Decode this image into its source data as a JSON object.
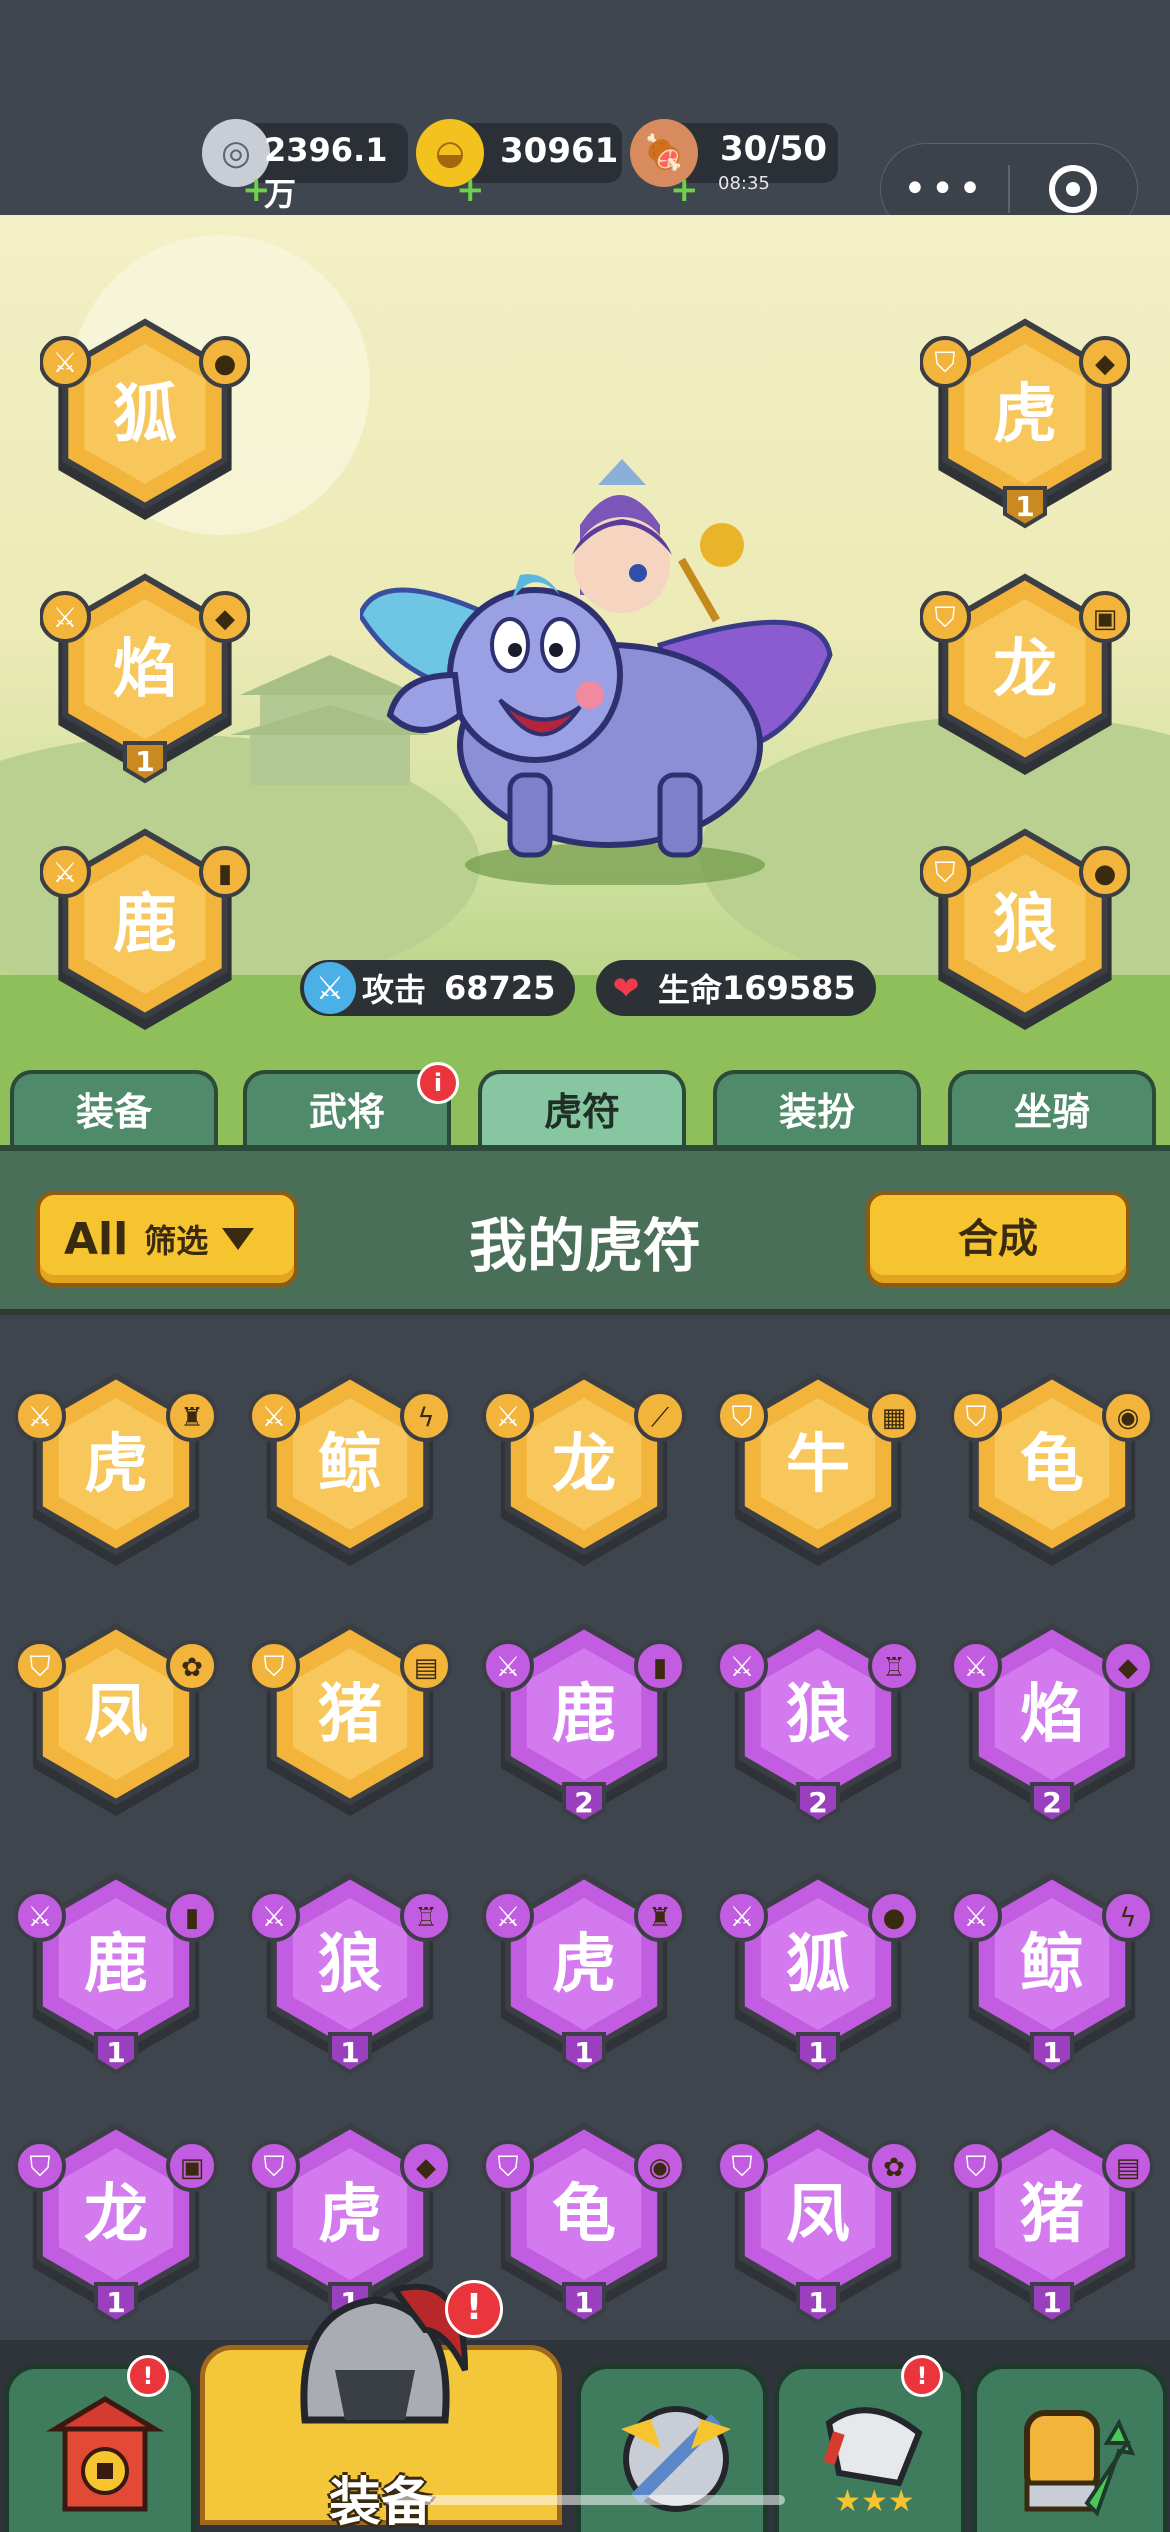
{
  "resources": {
    "silver": {
      "value": "2396.1万",
      "icon": "silver-coin-icon"
    },
    "gold": {
      "value": "30961",
      "icon": "gold-ingot-icon"
    },
    "stamina": {
      "value": "30/50",
      "timer": "08:35",
      "icon": "meat-icon"
    }
  },
  "capsule": {
    "more": "•••"
  },
  "stats": {
    "attack_label": "攻击",
    "attack_value": "68725",
    "hp_label": "生命",
    "hp_value": "169585"
  },
  "equipped_slots": {
    "left": [
      {
        "creature": "fox",
        "item": "boulder",
        "type": "sword",
        "level": ""
      },
      {
        "creature": "flame",
        "item": "armor",
        "type": "sword",
        "level": "1"
      },
      {
        "creature": "deer",
        "item": "scroll",
        "type": "sword",
        "level": ""
      }
    ],
    "right": [
      {
        "creature": "tiger",
        "item": "crystal",
        "type": "shield",
        "level": "1"
      },
      {
        "creature": "dragon",
        "item": "bag",
        "type": "shield",
        "level": ""
      },
      {
        "creature": "wolf",
        "item": "shell",
        "type": "shield",
        "level": ""
      }
    ]
  },
  "tabs": [
    {
      "label": "装备",
      "active": false,
      "badge": ""
    },
    {
      "label": "武将",
      "active": false,
      "badge": "i"
    },
    {
      "label": "虎符",
      "active": true,
      "badge": ""
    },
    {
      "label": "装扮",
      "active": false,
      "badge": ""
    },
    {
      "label": "坐骑",
      "active": false,
      "badge": ""
    }
  ],
  "panel": {
    "filter_all": "All",
    "filter_label": "筛选",
    "title": "我的虎符",
    "merge_label": "合成"
  },
  "tallies": [
    {
      "creature": "tiger",
      "item": "figure",
      "type": "sword",
      "rarity": "gold",
      "level": ""
    },
    {
      "creature": "whale",
      "item": "lightning",
      "type": "sword",
      "rarity": "gold",
      "level": ""
    },
    {
      "creature": "dragon",
      "item": "staff",
      "type": "sword",
      "rarity": "gold",
      "level": ""
    },
    {
      "creature": "ox",
      "item": "tome",
      "type": "shield",
      "rarity": "gold",
      "level": ""
    },
    {
      "creature": "turtle",
      "item": "coin",
      "type": "shield",
      "rarity": "gold",
      "level": ""
    },
    {
      "creature": "phoenix",
      "item": "lotus",
      "type": "shield",
      "rarity": "gold",
      "level": ""
    },
    {
      "creature": "boar",
      "item": "map",
      "type": "shield",
      "rarity": "gold",
      "level": ""
    },
    {
      "creature": "deer",
      "item": "scroll",
      "type": "sword",
      "rarity": "purple",
      "level": "2"
    },
    {
      "creature": "wolf",
      "item": "lantern",
      "type": "sword",
      "rarity": "purple",
      "level": "2"
    },
    {
      "creature": "flame",
      "item": "armor",
      "type": "sword",
      "rarity": "purple",
      "level": "2"
    },
    {
      "creature": "deer",
      "item": "scroll",
      "type": "sword",
      "rarity": "purple",
      "level": "1"
    },
    {
      "creature": "wolf",
      "item": "lantern",
      "type": "sword",
      "rarity": "purple",
      "level": "1"
    },
    {
      "creature": "tiger",
      "item": "figure",
      "type": "sword",
      "rarity": "purple",
      "level": "1"
    },
    {
      "creature": "fox",
      "item": "boulder",
      "type": "sword",
      "rarity": "purple",
      "level": "1"
    },
    {
      "creature": "whale",
      "item": "lightning",
      "type": "sword",
      "rarity": "purple",
      "level": "1"
    },
    {
      "creature": "dragon",
      "item": "bag",
      "type": "shield",
      "rarity": "purple",
      "level": "1"
    },
    {
      "creature": "tiger",
      "item": "crystal",
      "type": "shield",
      "rarity": "purple",
      "level": "1"
    },
    {
      "creature": "turtle",
      "item": "coin",
      "type": "shield",
      "rarity": "purple",
      "level": "1"
    },
    {
      "creature": "phoenix",
      "item": "lotus",
      "type": "shield",
      "rarity": "purple",
      "level": "1"
    },
    {
      "creature": "boar",
      "item": "map",
      "type": "shield",
      "rarity": "purple",
      "level": "1"
    }
  ],
  "bottom_nav": [
    {
      "icon": "gate-icon",
      "label": "",
      "active": false,
      "badge": "!"
    },
    {
      "icon": "helmet-icon",
      "label": "装备",
      "active": true,
      "badge": "!"
    },
    {
      "icon": "swords-icon",
      "label": "",
      "active": false,
      "badge": ""
    },
    {
      "icon": "rank-icon",
      "label": "",
      "active": false,
      "badge": "!"
    },
    {
      "icon": "fist-upgrade-icon",
      "label": "",
      "active": false,
      "badge": ""
    }
  ],
  "colors": {
    "gold": "#f2b43a",
    "purple": "#c25ce0",
    "frame": "#3b3f45",
    "accent_yellow": "#f6c42f"
  }
}
